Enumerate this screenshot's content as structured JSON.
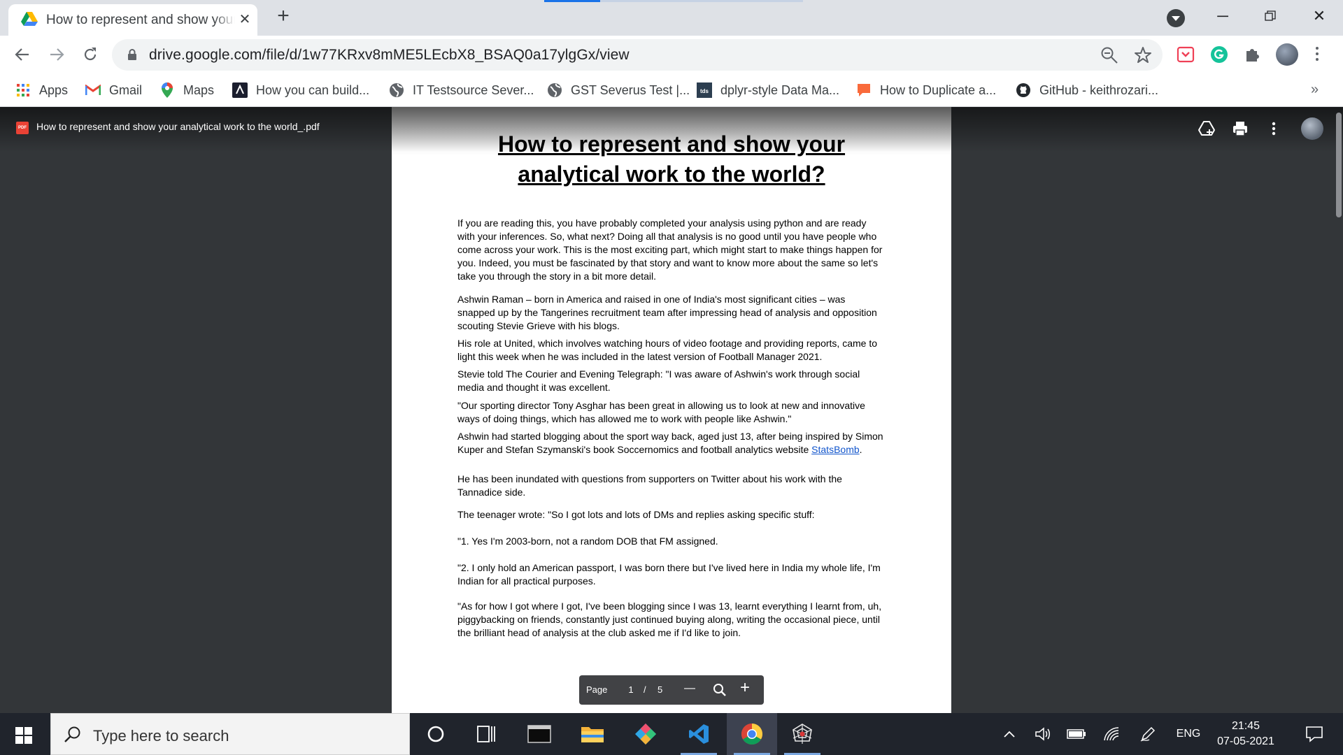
{
  "browser": {
    "tab_title": "How to represent and show your analytical work to the world_.pdf",
    "url": "drive.google.com/file/d/1w77KRxv8mME5LEcbX8_BSAQ0a17ylgGx/view",
    "bookmarks": [
      {
        "label": "Apps",
        "icon": "apps-grid-icon"
      },
      {
        "label": "Gmail",
        "icon": "gmail-icon"
      },
      {
        "label": "Maps",
        "icon": "maps-icon"
      },
      {
        "label": "How you can build...",
        "icon": "dark-logo-icon"
      },
      {
        "label": "IT Testsource Sever...",
        "icon": "globe-icon"
      },
      {
        "label": "GST Severus Test |...",
        "icon": "globe-icon"
      },
      {
        "label": "dplyr-style Data Ma...",
        "icon": "tds-icon"
      },
      {
        "label": "How to Duplicate a...",
        "icon": "speech-bubble-icon"
      },
      {
        "label": "GitHub - keithrozari...",
        "icon": "github-icon"
      }
    ]
  },
  "viewer": {
    "file_name": "How to represent and show your analytical work to the world_.pdf",
    "pdf_badge": "PDF",
    "pager": {
      "label": "Page",
      "current": "1",
      "separator": "/",
      "total": "5",
      "zoom_out": "—",
      "zoom_in": "+"
    }
  },
  "document": {
    "title_line1": "How to represent and show your",
    "title_line2": "analytical work to the world?",
    "paragraphs": [
      "If you are reading this, you have probably completed your analysis using python and are ready with your inferences. So, what next? Doing all that analysis is no good until you have people who come across your work. This is the most exciting part, which might start to make things happen for you. Indeed, you must be fascinated by that story and want to know more about the same so let's take you through the story in a bit more detail.",
      "Ashwin Raman – born in America and raised in one of India's most significant cities – was snapped up by the Tangerines recruitment team after impressing head of analysis and opposition scouting Stevie Grieve with his blogs.",
      "His role at United, which involves watching hours of video footage and providing reports, came to light this week when he was included in the latest version of Football Manager 2021.",
      "Stevie told The Courier and Evening Telegraph: \"I was aware of Ashwin's work through social media and thought it was excellent.",
      "\"Our sporting director Tony Asghar has been great in allowing us to look at new and innovative ways of doing things, which has allowed me to work with people like Ashwin.\"",
      "Ashwin had started blogging about the sport way back, aged just 13, after being inspired by Simon Kuper and Stefan Szymanski's book Soccernomics and football analytics website",
      "StatsBomb",
      ".",
      "He has been inundated with questions from supporters on Twitter about his work with the Tannadice side.",
      "The teenager wrote: \"So I got lots and lots of DMs and replies asking specific stuff:",
      "\"1. Yes I'm 2003-born, not a random DOB that FM assigned.",
      "\"2. I only hold an American passport, I was born there but I've lived here in India my whole life, I'm Indian for all practical purposes.",
      "\"As for how I got where I got, I've been blogging since I was 13, learnt everything I learnt from, uh, piggybacking on friends, constantly just continued buying along, writing the occasional piece, until the brilliant head of analysis at the club asked me if I'd like to join."
    ]
  },
  "taskbar": {
    "search_placeholder": "Type here to search",
    "language": "ENG",
    "time": "21:45",
    "date": "07-05-2021"
  },
  "colors": {
    "chrome_tabstrip": "#dee1e6",
    "viewer_bg": "#333639",
    "accent_blue": "#1a73e8",
    "taskbar": "#20242c",
    "link": "#1155cc"
  }
}
